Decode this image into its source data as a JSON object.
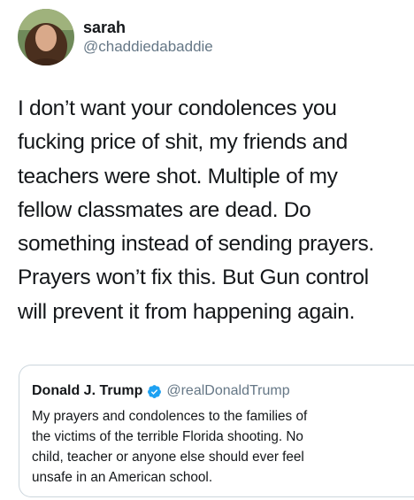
{
  "tweet": {
    "author": {
      "display_name": "sarah",
      "handle": "@chaddiedabaddie"
    },
    "text_lines": [
      "I don’t want your condolences you",
      "fucking price of shit, my friends and",
      "teachers were shot. Multiple of my",
      "fellow classmates are dead. Do",
      "something instead of sending prayers.",
      "Prayers won’t fix this. But Gun control",
      "will prevent it from happening again."
    ]
  },
  "quoted_tweet": {
    "author": {
      "display_name": "Donald J. Trump",
      "handle": "@realDonaldTrump",
      "verified_icon": "verified-badge-icon"
    },
    "text_lines": [
      "My prayers and condolences to the families of",
      "the victims of the terrible Florida shooting. No",
      "child, teacher or anyone else should ever feel",
      "unsafe in an American school."
    ]
  },
  "colors": {
    "text": "#14171a",
    "secondary_text": "#657786",
    "border": "#ccd6dd",
    "verified_blue": "#1da1f2"
  }
}
